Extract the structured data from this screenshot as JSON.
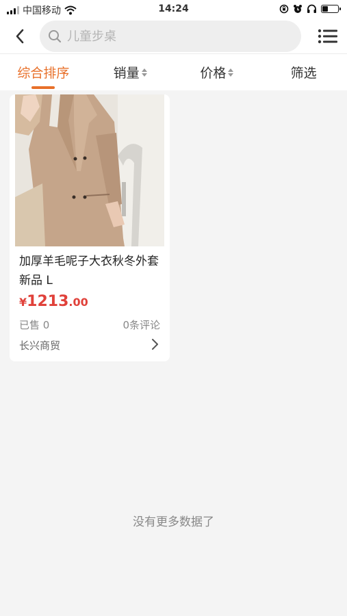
{
  "status_bar": {
    "carrier": "中国移动",
    "time": "14:24",
    "icons": [
      "signal-icon",
      "wifi-icon",
      "orientation-lock-icon",
      "alarm-icon",
      "headphones-icon",
      "battery-icon"
    ],
    "battery_level": 0.35
  },
  "header": {
    "back_icon": "chevron-left-icon",
    "search_placeholder": "儿童步桌",
    "search_icon": "search-icon",
    "menu_icon": "list-menu-icon"
  },
  "tabs": [
    {
      "label": "综合排序",
      "active": true
    },
    {
      "label": "销量",
      "sortable": true
    },
    {
      "label": "价格",
      "sortable": true
    },
    {
      "label": "筛选"
    }
  ],
  "product": {
    "title": "加厚羊毛呢子大衣秋冬外套新品 L",
    "price_symbol": "¥",
    "price_int": "1213",
    "price_dec": ".00",
    "sold": "已售 0",
    "reviews": "0条评论",
    "shop": "长兴商贸"
  },
  "footer": {
    "no_more": "没有更多数据了"
  },
  "colors": {
    "accent": "#e8702a",
    "price": "#e0413a",
    "background": "#f4f4f4"
  }
}
